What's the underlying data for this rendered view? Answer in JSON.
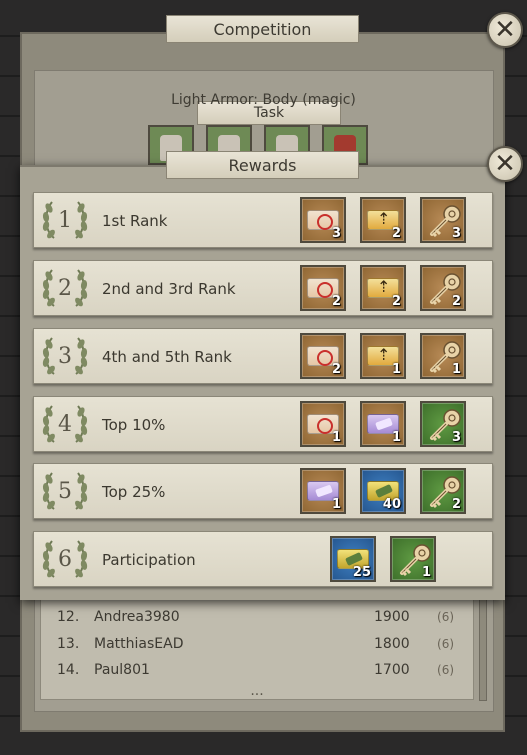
{
  "competition": {
    "title": "Competition",
    "task_tab": "Task",
    "task_text": "Light Armor: Body (magic)"
  },
  "rewards": {
    "title": "Rewards",
    "rows": [
      {
        "num": "1",
        "label": "1st Rank",
        "items": [
          {
            "icon": "repair-ticket-icon",
            "bg": "brown",
            "qty": "3"
          },
          {
            "icon": "upgrade-ticket-icon",
            "bg": "brown",
            "qty": "2"
          },
          {
            "icon": "key-icon",
            "bg": "brown",
            "qty": "3"
          }
        ]
      },
      {
        "num": "2",
        "label": "2nd and 3rd Rank",
        "items": [
          {
            "icon": "repair-ticket-icon",
            "bg": "brown",
            "qty": "2"
          },
          {
            "icon": "upgrade-ticket-icon",
            "bg": "brown",
            "qty": "2"
          },
          {
            "icon": "key-icon",
            "bg": "brown",
            "qty": "2"
          }
        ]
      },
      {
        "num": "3",
        "label": "4th and 5th Rank",
        "items": [
          {
            "icon": "repair-ticket-icon",
            "bg": "brown",
            "qty": "2"
          },
          {
            "icon": "upgrade-ticket-icon",
            "bg": "brown",
            "qty": "1"
          },
          {
            "icon": "key-icon",
            "bg": "brown",
            "qty": "1"
          }
        ]
      },
      {
        "num": "4",
        "label": "Top 10%",
        "items": [
          {
            "icon": "repair-ticket-icon",
            "bg": "brown",
            "qty": "1"
          },
          {
            "icon": "feather-ticket-icon",
            "bg": "brown",
            "qty": "1"
          },
          {
            "icon": "key-icon",
            "bg": "green",
            "qty": "3"
          }
        ]
      },
      {
        "num": "5",
        "label": "Top 25%",
        "items": [
          {
            "icon": "feather-ticket-icon",
            "bg": "brown",
            "qty": "1"
          },
          {
            "icon": "hammer-ticket-icon",
            "bg": "blue",
            "qty": "40"
          },
          {
            "icon": "key-icon",
            "bg": "green",
            "qty": "2"
          }
        ]
      },
      {
        "num": "6",
        "label": "Participation",
        "items": [
          {
            "icon": "hammer-ticket-icon",
            "bg": "blue",
            "qty": "25"
          },
          {
            "icon": "key-icon",
            "bg": "green",
            "qty": "1"
          }
        ]
      }
    ]
  },
  "leaderboard": {
    "rows": [
      {
        "rank": "12.",
        "name": "Andrea3980",
        "points": "1900",
        "badge": "6"
      },
      {
        "rank": "13.",
        "name": "MatthiasEAD",
        "points": "1800",
        "badge": "6"
      },
      {
        "rank": "14.",
        "name": "Paul801",
        "points": "1700",
        "badge": "6"
      }
    ],
    "more": "..."
  },
  "close_label": "✕"
}
